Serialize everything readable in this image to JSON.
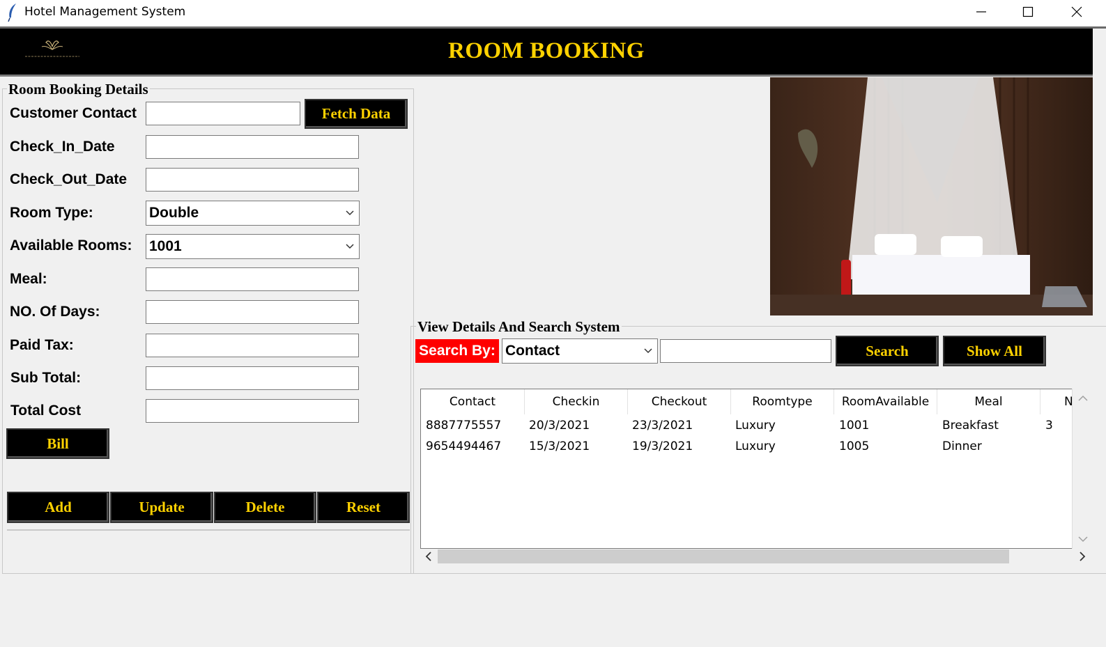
{
  "window": {
    "title": "Hotel Management System"
  },
  "header": {
    "title": "ROOM BOOKING"
  },
  "booking_form": {
    "legend": "Room Booking Details",
    "customer_contact_label": "Customer Contact",
    "fetch_button": "Fetch Data",
    "check_in_label": "Check_In_Date",
    "check_out_label": "Check_Out_Date",
    "room_type_label": "Room Type:",
    "room_type_value": "Double",
    "available_rooms_label": "Available Rooms:",
    "available_rooms_value": "1001",
    "meal_label": "Meal:",
    "days_label": "NO. Of Days:",
    "paid_tax_label": "Paid Tax:",
    "sub_total_label": "Sub Total:",
    "total_cost_label": "Total Cost",
    "bill_button": "Bill",
    "add_button": "Add",
    "update_button": "Update",
    "delete_button": "Delete",
    "reset_button": "Reset"
  },
  "search_panel": {
    "legend": "View Details And Search System",
    "search_by_label": "Search By:",
    "search_by_value": "Contact",
    "search_button": "Search",
    "show_all_button": "Show All"
  },
  "table": {
    "columns": [
      "Contact",
      "Checkin",
      "Checkout",
      "Roomtype",
      "RoomAvailable",
      "Meal",
      "N"
    ],
    "rows": [
      [
        "8887775557",
        "20/3/2021",
        "23/3/2021",
        "Luxury",
        "1001",
        "Breakfast",
        "3"
      ],
      [
        "9654494467",
        "15/3/2021",
        "19/3/2021",
        "Luxury",
        "1005",
        "Dinner",
        ""
      ]
    ]
  },
  "colors": {
    "header_bg": "#000000",
    "accent_gold": "#ffd200",
    "search_label_bg": "#ff0000"
  }
}
